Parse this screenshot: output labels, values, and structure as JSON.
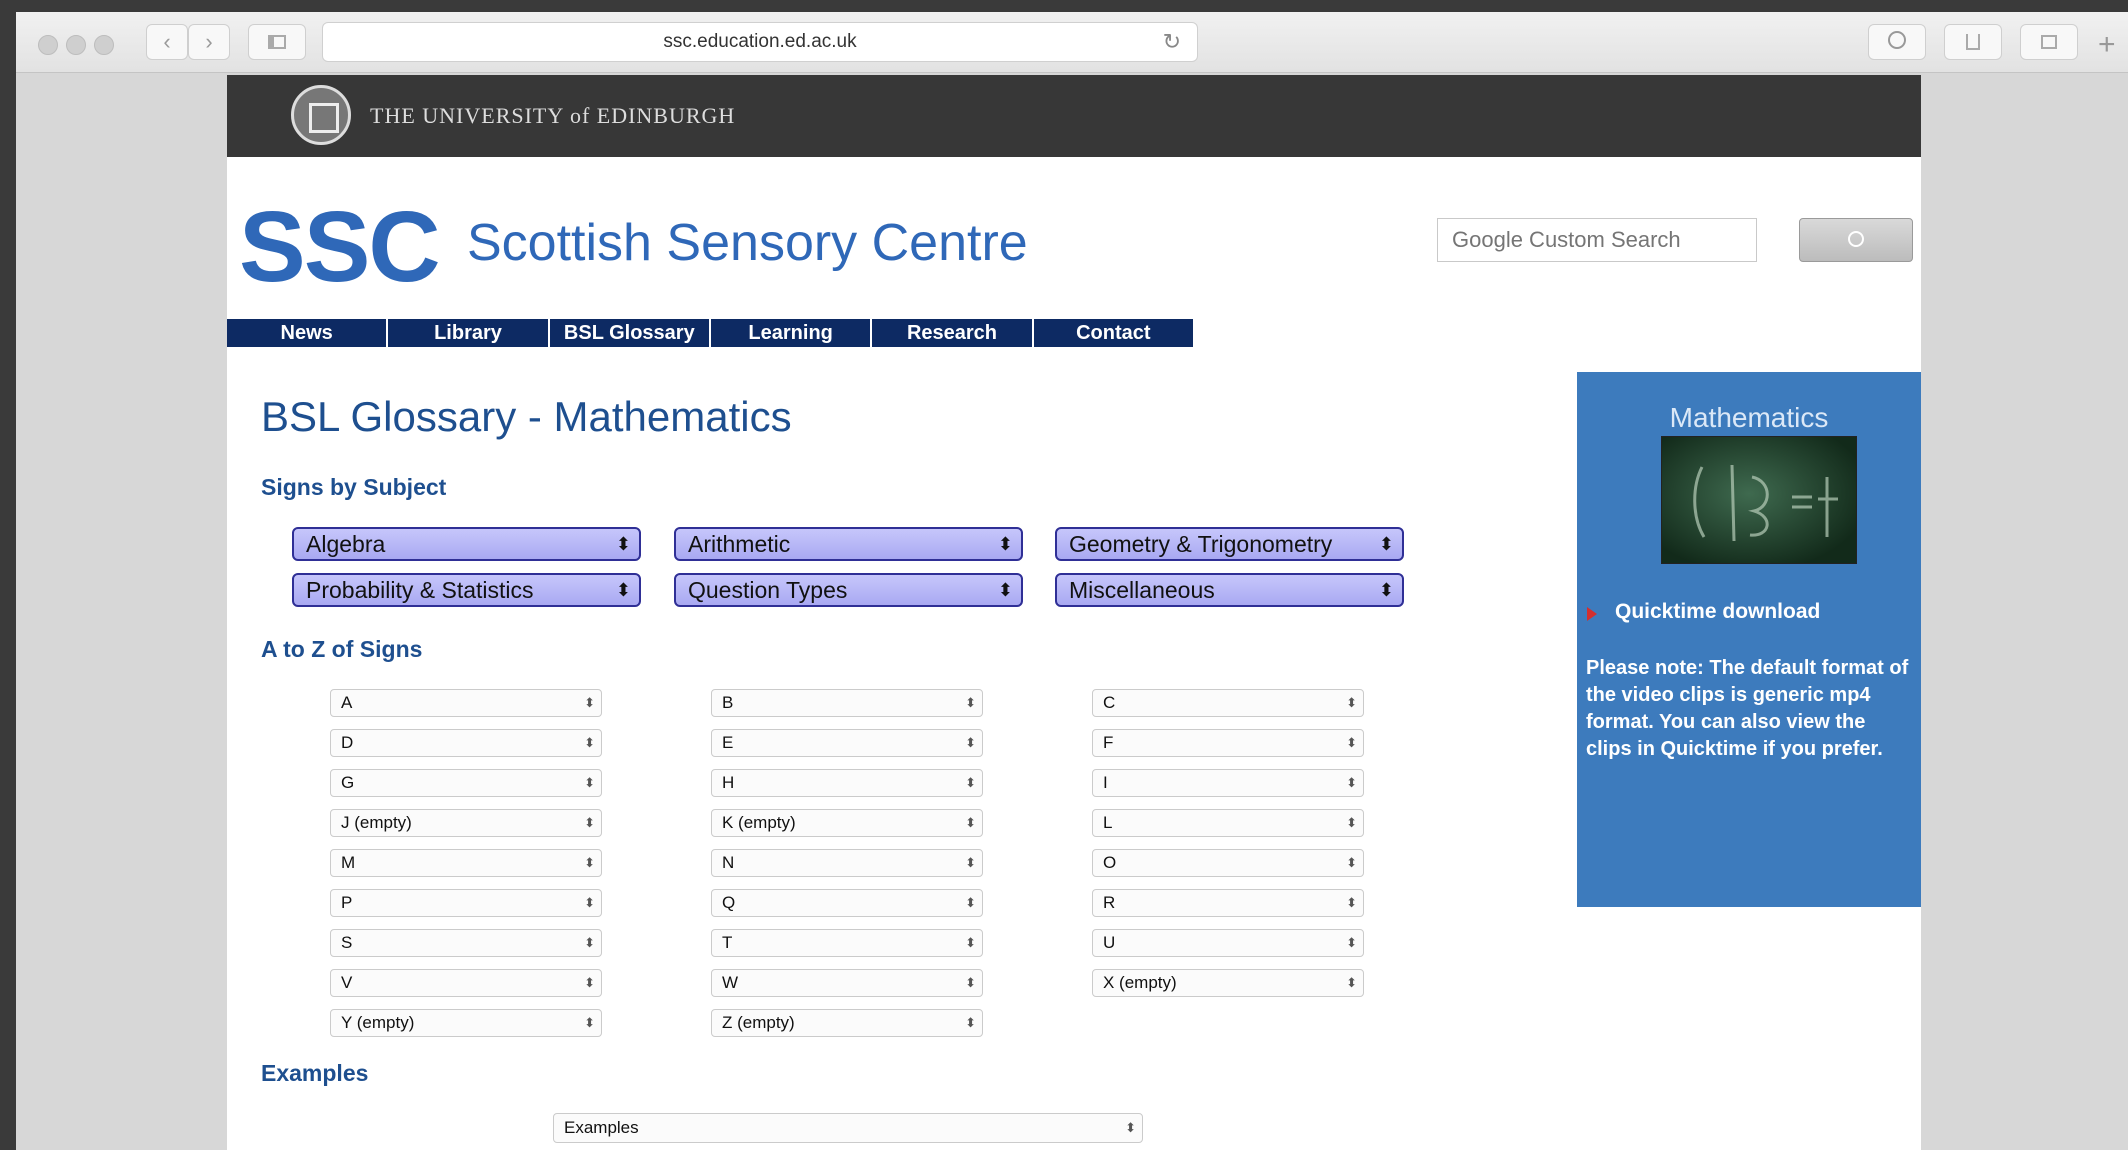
{
  "browser": {
    "url": "ssc.education.ed.ac.uk",
    "back_icon": "‹",
    "forward_icon": "›",
    "reload_icon": "↻",
    "new_tab_icon": "+"
  },
  "header": {
    "university": "THE UNIVERSITY of EDINBURGH",
    "logo_short": "SSC",
    "logo_full": "Scottish Sensory Centre",
    "search_placeholder": "Google Custom Search",
    "search_button_icon": "🔍"
  },
  "nav": [
    "News",
    "Library",
    "BSL Glossary",
    "Learning",
    "Research",
    "Contact"
  ],
  "main": {
    "title": "BSL Glossary - Mathematics",
    "signs_by_subject": "Signs by Subject",
    "subjects": [
      "Algebra",
      "Arithmetic",
      "Geometry & Trigonometry",
      "Probability & Statistics",
      "Question Types",
      "Miscellaneous"
    ],
    "a_to_z_heading": "A to Z of Signs",
    "letters": [
      "A",
      "B",
      "C",
      "D",
      "E",
      "F",
      "G",
      "H",
      "I",
      "J (empty)",
      "K (empty)",
      "L",
      "M",
      "N",
      "O",
      "P",
      "Q",
      "R",
      "S",
      "T",
      "U",
      "V",
      "W",
      "X (empty)",
      "Y (empty)",
      "Z (empty)"
    ],
    "examples_heading": "Examples",
    "examples_select": "Examples"
  },
  "sidebar": {
    "title": "Mathematics",
    "link": "Quicktime download",
    "note": "Please note: The default format of the video clips is generic mp4 format. You can also view the clips in Quicktime if you prefer."
  },
  "colors": {
    "brand_blue": "#2f68b8",
    "nav_bg": "#0d2a63",
    "sidebar_bg": "#3d7bbd",
    "heading": "#1e4f8f"
  }
}
